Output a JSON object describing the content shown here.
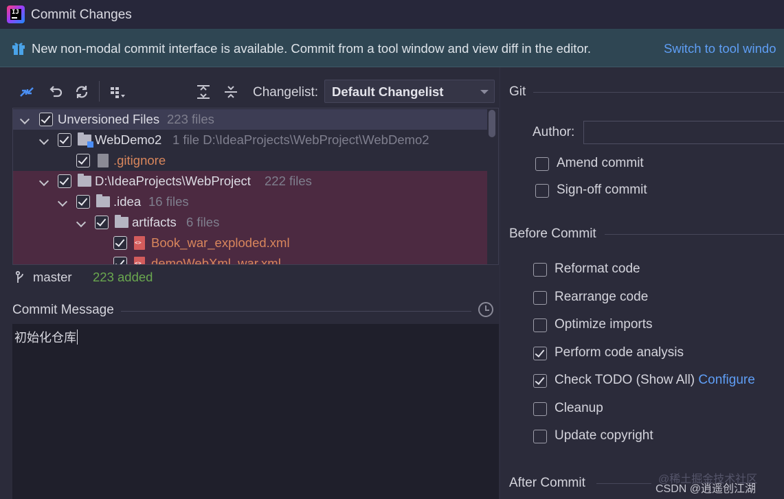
{
  "window": {
    "title": "Commit Changes"
  },
  "banner": {
    "text": "New non-modal commit interface is available. Commit from a tool window and view diff in the editor.",
    "link": "Switch to tool windo"
  },
  "toolbar": {
    "changelist_label": "Changelist:",
    "changelist_value": "Default Changelist"
  },
  "tree": {
    "rows": [
      {
        "name": "Unversioned Files",
        "meta": "223 files"
      },
      {
        "name": "WebDemo2",
        "meta": "1 file  D:\\IdeaProjects\\WebProject\\WebDemo2"
      },
      {
        "name": ".gitignore",
        "meta": ""
      },
      {
        "name": "D:\\IdeaProjects\\WebProject",
        "meta": "222 files"
      },
      {
        "name": ".idea",
        "meta": "16 files"
      },
      {
        "name": "artifacts",
        "meta": "6 files"
      },
      {
        "name": "Book_war_exploded.xml",
        "meta": ""
      },
      {
        "name": "demoWebXml_war.xml",
        "meta": ""
      }
    ]
  },
  "status": {
    "branch": "master",
    "added": "223 added"
  },
  "commit_message": {
    "label": "Commit Message",
    "text": "初始化仓库"
  },
  "git": {
    "title": "Git",
    "author_label": "Author:",
    "author_value": "",
    "options": [
      {
        "label": "Amend commit",
        "checked": false
      },
      {
        "label": "Sign-off commit",
        "checked": false
      }
    ]
  },
  "before_commit": {
    "title": "Before Commit",
    "options": [
      {
        "label": "Reformat code",
        "checked": false
      },
      {
        "label": "Rearrange code",
        "checked": false
      },
      {
        "label": "Optimize imports",
        "checked": false
      },
      {
        "label": "Perform code analysis",
        "checked": true
      },
      {
        "label": "Check TODO (Show All)",
        "link": "Configure",
        "checked": true
      },
      {
        "label": "Cleanup",
        "checked": false
      },
      {
        "label": "Update copyright",
        "checked": false
      }
    ]
  },
  "after_commit": {
    "title": "After Commit"
  },
  "watermark": {
    "line1": "@稀土掘金技术社区",
    "line2": "CSDN @逍遥创江湖"
  },
  "colors": {
    "accent_link": "#5f9ef5",
    "added_green": "#6aa84f",
    "unversioned_orange": "#d9865c",
    "banner_bg": "#2f4653"
  }
}
